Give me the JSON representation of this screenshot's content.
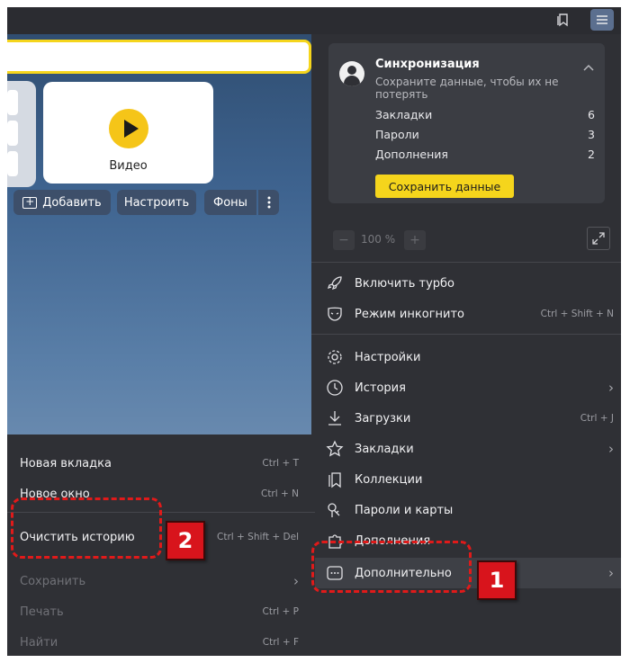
{
  "page": {
    "tiles": {
      "video_label": "Видео"
    },
    "toolbar": {
      "add_label": "Добавить",
      "customize_label": "Настроить",
      "backgrounds_label": "Фоны"
    }
  },
  "sync": {
    "title": "Синхронизация",
    "subtitle": "Сохраните данные, чтобы их не потерять",
    "rows": [
      {
        "label": "Закладки",
        "count": "6"
      },
      {
        "label": "Пароли",
        "count": "3"
      },
      {
        "label": "Дополнения",
        "count": "2"
      }
    ],
    "save_button": "Сохранить данные"
  },
  "zoom": {
    "minus": "−",
    "value": "100 %",
    "plus": "+"
  },
  "menu": {
    "turbo": "Включить турбо",
    "incognito": {
      "label": "Режим инкогнито",
      "shortcut": "Ctrl + Shift + N"
    },
    "settings": "Настройки",
    "history": "История",
    "downloads": {
      "label": "Загрузки",
      "shortcut": "Ctrl + J"
    },
    "bookmarks": "Закладки",
    "collections": "Коллекции",
    "passwords": "Пароли и карты",
    "extensions": "Дополнения",
    "more": "Дополнительно"
  },
  "submenu": {
    "new_tab": {
      "label": "Новая вкладка",
      "shortcut": "Ctrl + T"
    },
    "new_window": {
      "label": "Новое окно",
      "shortcut": "Ctrl + N"
    },
    "clear_history": {
      "label": "Очистить историю",
      "shortcut": "Ctrl + Shift + Del"
    },
    "save": {
      "label": "Сохранить"
    },
    "print": {
      "label": "Печать",
      "shortcut": "Ctrl + P"
    },
    "find": {
      "label": "Найти",
      "shortcut": "Ctrl + F"
    }
  },
  "annotations": {
    "badge1": "1",
    "badge2": "2"
  },
  "colors": {
    "accent_yellow": "#f5d51c",
    "annotation_red": "#d8141c",
    "menu_bg": "#2f3035"
  }
}
